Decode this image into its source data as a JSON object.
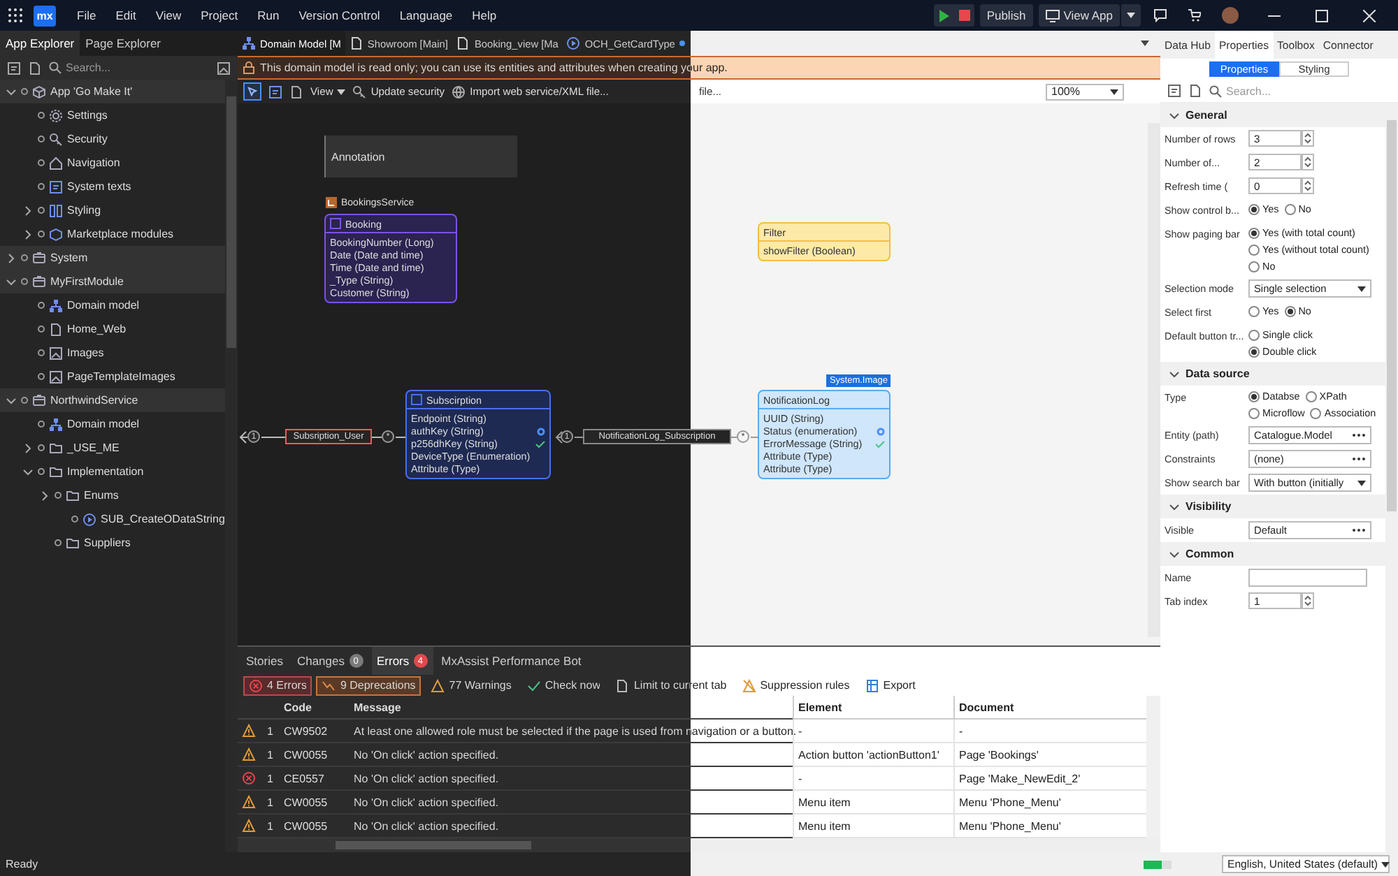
{
  "menu_bar": {
    "logo": "mx",
    "items": [
      "File",
      "Edit",
      "View",
      "Project",
      "Run",
      "Version Control",
      "Language",
      "Help"
    ],
    "publish": "Publish",
    "view_app": "View App"
  },
  "app_explorer": {
    "tabs": [
      {
        "label": "App Explorer",
        "selected": true
      },
      {
        "label": "Page Explorer",
        "selected": false
      }
    ],
    "search": {
      "placeholder": "Search..."
    },
    "tree": [
      {
        "label": "App 'Go Make It'",
        "kind": "app",
        "expanded": true,
        "children": [
          {
            "label": "Settings",
            "kind": "gear"
          },
          {
            "label": "Security",
            "kind": "key"
          },
          {
            "label": "Navigation",
            "kind": "home"
          },
          {
            "label": "System texts",
            "kind": "texts"
          },
          {
            "label": "Styling",
            "kind": "styling",
            "expanded": false
          },
          {
            "label": "Marketplace modules",
            "kind": "marketplace",
            "expanded": false
          }
        ]
      },
      {
        "label": "System",
        "kind": "module",
        "expanded": false
      },
      {
        "label": "MyFirstModule",
        "kind": "module",
        "expanded": true,
        "children": [
          {
            "label": "Domain model",
            "kind": "domain"
          },
          {
            "label": "Home_Web",
            "kind": "page"
          },
          {
            "label": "Images",
            "kind": "image"
          },
          {
            "label": "PageTemplateImages",
            "kind": "image"
          }
        ]
      },
      {
        "label": "NorthwindService",
        "kind": "module",
        "expanded": true,
        "children": [
          {
            "label": "Domain model",
            "kind": "domain"
          },
          {
            "label": "_USE_ME",
            "kind": "folder",
            "expanded": false
          },
          {
            "label": "Implementation",
            "kind": "folder",
            "expanded": true,
            "children": [
              {
                "label": "Enums",
                "kind": "folder",
                "expanded": false,
                "children": [
                  {
                    "label": "SUB_CreateODataString",
                    "kind": "microflow"
                  }
                ]
              },
              {
                "label": "Suppliers",
                "kind": "folder"
              }
            ]
          }
        ]
      }
    ]
  },
  "editor": {
    "tabs": [
      {
        "label": "Domain Model [M",
        "kind": "domain",
        "selected": true,
        "modified": false
      },
      {
        "label": "Showroom [Main]",
        "kind": "page",
        "selected": false,
        "modified": false
      },
      {
        "label": "Booking_view [Ma",
        "kind": "page",
        "selected": false,
        "modified": false
      },
      {
        "label": "OCH_GetCardType",
        "kind": "microflow",
        "selected": false,
        "modified": true
      }
    ],
    "notice": "This domain model is read only; you can use its entities and attributes when creating your app.",
    "toolbar": {
      "view": "View",
      "update_security": "Update security",
      "import": "Import web service/XML file...",
      "fragment": "file...",
      "zoom": "100%"
    },
    "annotation": "Annotation",
    "module_label": "BookingsService",
    "entities": [
      {
        "name": "Booking",
        "kind": "external",
        "attributes": [
          {
            "text": "BookingNumber (Long)",
            "kind": "plain"
          },
          {
            "text": "Date (Date and time)",
            "kind": "plain"
          },
          {
            "text": "Time (Date and time)",
            "kind": "plain"
          },
          {
            "text": "_Type (String)",
            "kind": "plain"
          },
          {
            "text": "Customer (String)",
            "kind": "plain"
          }
        ]
      },
      {
        "name": "Filter",
        "kind": "non_persistent",
        "attributes": [
          {
            "text": "showFilter (Boolean)",
            "kind": "plain"
          }
        ]
      },
      {
        "name": "Subscirption",
        "kind": "persistent",
        "attributes": [
          {
            "text": "Endpoint (String)",
            "kind": "plain"
          },
          {
            "text": "authKey (String)",
            "kind": "rule"
          },
          {
            "text": "p256dhKey (String)",
            "kind": "check"
          },
          {
            "text": "DeviceType (Enumeration)",
            "kind": "plain"
          },
          {
            "text": "Attribute (Type)",
            "kind": "plain"
          }
        ]
      },
      {
        "name": "NotificationLog",
        "kind": "system",
        "tag": "System.Image",
        "attributes": [
          {
            "text": "UUID (String)",
            "kind": "plain"
          },
          {
            "text": "Status (enumeration)",
            "kind": "rule"
          },
          {
            "text": "ErrorMessage (String)",
            "kind": "check"
          },
          {
            "text": "Attribute (Type)",
            "kind": "plain"
          },
          {
            "text": "Attribute (Type)",
            "kind": "plain"
          }
        ]
      }
    ],
    "associations": [
      {
        "label": "Subsription_User",
        "kind": "invalid",
        "from": "1",
        "to": "*"
      },
      {
        "label": "NotificationLog_Subscription",
        "kind": "valid",
        "from": "1",
        "to": "*"
      }
    ]
  },
  "bottom_panel": {
    "tabs": [
      {
        "label": "Stories",
        "selected": false
      },
      {
        "label": "Changes",
        "badge": "0",
        "color": "#7a7a7a",
        "selected": false
      },
      {
        "label": "Errors",
        "badge": "4",
        "color": "#e5484d",
        "selected": true
      },
      {
        "label": "MxAssist Performance Bot",
        "selected": false
      }
    ],
    "filters": [
      {
        "label": "4 Errors",
        "kind": "error",
        "on": true
      },
      {
        "label": "9 Deprecations",
        "kind": "deprecation",
        "on": true
      },
      {
        "label": "77 Warnings",
        "kind": "warning",
        "on": false
      },
      {
        "label": "Check now",
        "kind": "check",
        "on": false
      },
      {
        "label": "Limit to current tab",
        "kind": "limit",
        "on": false
      },
      {
        "label": "Suppression rules",
        "kind": "suppress",
        "on": false
      },
      {
        "label": "Export",
        "kind": "export",
        "on": false
      }
    ],
    "columns": [
      "Code",
      "Message",
      "Element",
      "Document"
    ],
    "rows": [
      {
        "kind": "warning",
        "count": "1",
        "code": "CW9502",
        "message": "At least one allowed role must be selected if the page is used from navigation or a button.",
        "element": "-",
        "document": "-"
      },
      {
        "kind": "warning",
        "count": "1",
        "code": "CW0055",
        "message": "No 'On click' action specified.",
        "element": "Action button 'actionButton1'",
        "document": "Page 'Bookings'"
      },
      {
        "kind": "error",
        "count": "1",
        "code": "CE0557",
        "message": "No 'On click' action specified.",
        "element": "-",
        "document": "Page 'Make_NewEdit_2'"
      },
      {
        "kind": "warning",
        "count": "1",
        "code": "CW0055",
        "message": "No 'On click' action specified.",
        "element": "Menu item",
        "document": "Menu 'Phone_Menu'"
      },
      {
        "kind": "warning",
        "count": "1",
        "code": "CW0055",
        "message": "No 'On click' action specified.",
        "element": "Menu item",
        "document": "Menu 'Phone_Menu'"
      }
    ]
  },
  "properties_panel": {
    "tabs": [
      {
        "label": "Data Hub",
        "selected": false
      },
      {
        "label": "Properties",
        "selected": true
      },
      {
        "label": "Toolbox",
        "selected": false
      },
      {
        "label": "Connector",
        "selected": false
      }
    ],
    "modes": [
      {
        "label": "Properties",
        "selected": true
      },
      {
        "label": "Styling",
        "selected": false
      }
    ],
    "search": {
      "placeholder": "Search..."
    },
    "sections": [
      {
        "title": "General",
        "expanded": true,
        "rows": [
          {
            "label": "Number of rows",
            "kind": "number",
            "value": "3"
          },
          {
            "label": "Number of...",
            "kind": "number",
            "value": "2"
          },
          {
            "label": "Refresh time (",
            "kind": "number",
            "value": "0"
          },
          {
            "label": "Show control b...",
            "kind": "radio",
            "options": [
              {
                "label": "Yes",
                "selected": true
              },
              {
                "label": "No",
                "selected": false
              }
            ]
          },
          {
            "label": "Show paging bar",
            "kind": "radio",
            "options": [
              {
                "label": "Yes (with total count)",
                "selected": true
              },
              {
                "label": "Yes (without total count)",
                "selected": false
              },
              {
                "label": "No",
                "selected": false
              }
            ]
          },
          {
            "label": "Selection mode",
            "kind": "select",
            "value": "Single selection"
          },
          {
            "label": "Select first",
            "kind": "radio",
            "options": [
              {
                "label": "Yes",
                "selected": false
              },
              {
                "label": "No",
                "selected": true
              }
            ]
          },
          {
            "label": "Default button tr...",
            "kind": "radio",
            "options": [
              {
                "label": "Single click",
                "selected": false
              },
              {
                "label": "Double click",
                "selected": true
              }
            ]
          }
        ]
      },
      {
        "title": "Data source",
        "expanded": true,
        "rows": [
          {
            "label": "Type",
            "kind": "radio",
            "options": [
              {
                "label": "Databse",
                "selected": true
              },
              {
                "label": "XPath",
                "selected": false
              },
              {
                "label": "Microflow",
                "selected": false
              },
              {
                "label": "Association",
                "selected": false
              }
            ]
          },
          {
            "label": "Entity (path)",
            "kind": "picker",
            "value": "Catalogue.Model"
          },
          {
            "label": "Constraints",
            "kind": "picker",
            "value": "(none)"
          },
          {
            "label": "Show search bar",
            "kind": "select",
            "value": "With button (initially"
          }
        ]
      },
      {
        "title": "Visibility",
        "expanded": true,
        "rows": [
          {
            "label": "Visible",
            "kind": "picker",
            "value": "Default"
          }
        ]
      },
      {
        "title": "Common",
        "expanded": true,
        "rows": [
          {
            "label": "Name",
            "kind": "text",
            "value": ""
          },
          {
            "label": "Tab index",
            "kind": "number",
            "value": "1"
          }
        ]
      }
    ]
  },
  "status_bar": {
    "text": "Ready",
    "language": "English, United States (default)"
  }
}
